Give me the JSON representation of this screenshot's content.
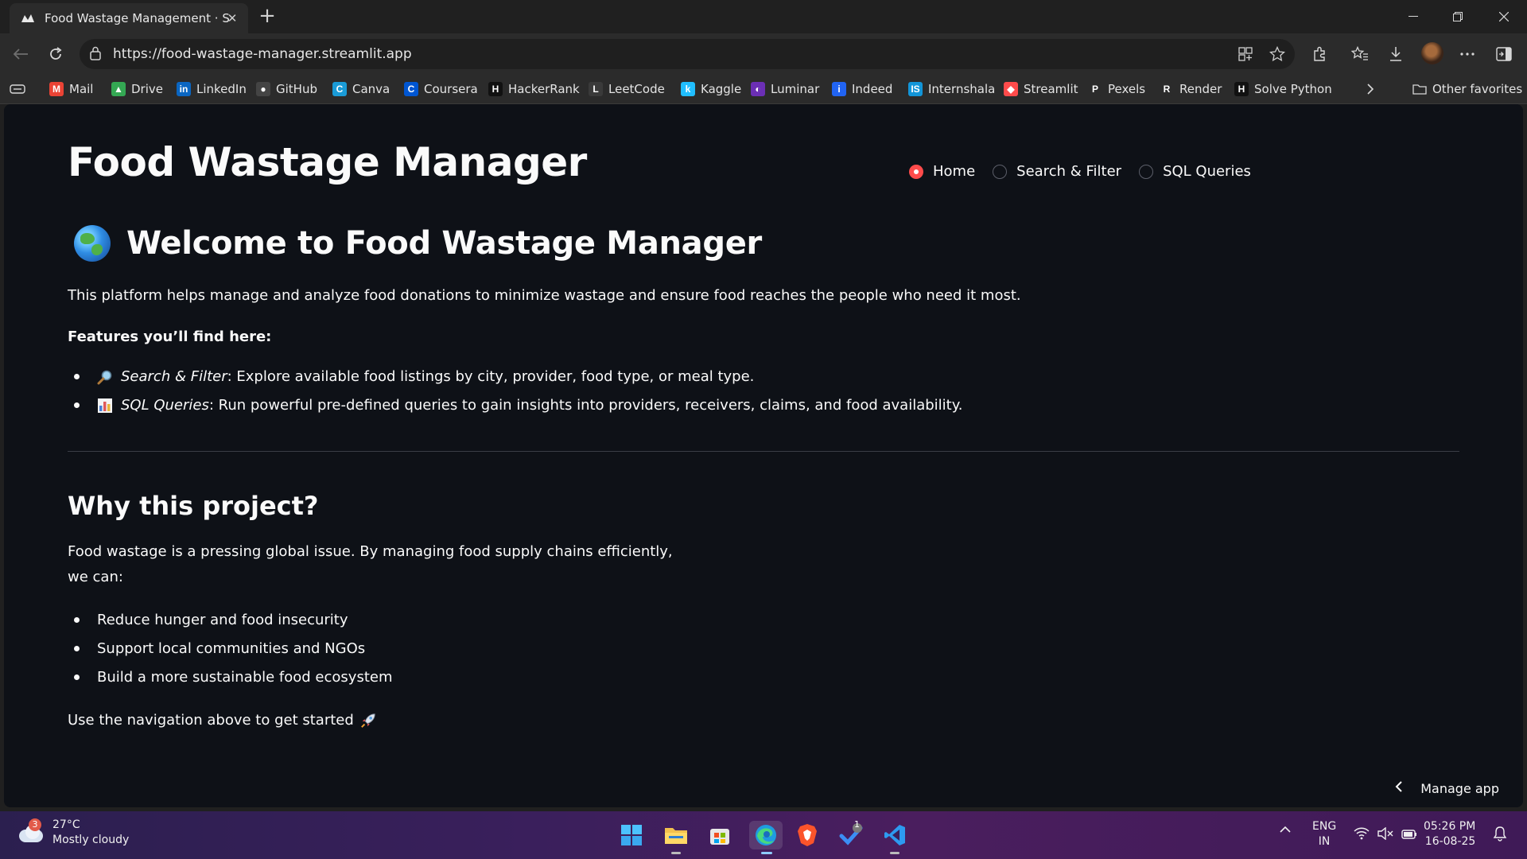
{
  "browser": {
    "tab_title": "Food Wastage Management · Streamlit",
    "url": "https://food-wastage-manager.streamlit.app",
    "bookmarks": [
      {
        "label": "Mail",
        "icon": "gmail-icon",
        "color": "#ea4335",
        "glyph": "M"
      },
      {
        "label": "Drive",
        "icon": "drive-icon",
        "color": "#34a853",
        "glyph": "▲"
      },
      {
        "label": "LinkedIn",
        "icon": "linkedin-icon",
        "color": "#0a66c2",
        "glyph": "in"
      },
      {
        "label": "GitHub",
        "icon": "github-icon",
        "color": "#444444",
        "glyph": "●"
      },
      {
        "label": "Canva",
        "icon": "canva-icon",
        "color": "#1a9bd7",
        "glyph": "C"
      },
      {
        "label": "Coursera",
        "icon": "coursera-icon",
        "color": "#0056d2",
        "glyph": "C"
      },
      {
        "label": "HackerRank",
        "icon": "hackerrank-icon",
        "color": "#111111",
        "glyph": "H"
      },
      {
        "label": "LeetCode",
        "icon": "leetcode-icon",
        "color": "#3a3a3a",
        "glyph": "L"
      },
      {
        "label": "Kaggle",
        "icon": "kaggle-icon",
        "color": "#20beff",
        "glyph": "k"
      },
      {
        "label": "Luminar",
        "icon": "luminar-icon",
        "color": "#6b2fb5",
        "glyph": "◐"
      },
      {
        "label": "Indeed",
        "icon": "indeed-icon",
        "color": "#2164f3",
        "glyph": "i"
      },
      {
        "label": "Internshala",
        "icon": "internshala-icon",
        "color": "#1295d8",
        "glyph": "IS"
      },
      {
        "label": "Streamlit",
        "icon": "streamlit-icon",
        "color": "#ff4b4b",
        "glyph": "◆"
      },
      {
        "label": "Pexels",
        "icon": "pexels-icon",
        "color": "#2b2b2b",
        "glyph": "P"
      },
      {
        "label": "Render",
        "icon": "render-icon",
        "color": "#2b2b2b",
        "glyph": "R"
      },
      {
        "label": "Solve Python",
        "icon": "solve-python-icon",
        "color": "#111111",
        "glyph": "H"
      }
    ],
    "other_favorites": "Other favorites"
  },
  "app": {
    "title": "Food Wastage Manager",
    "nav": [
      "Home",
      "Search & Filter",
      "SQL Queries"
    ],
    "nav_selected": "Home",
    "accent_color": "#ff4b4b",
    "welcome_heading": "Welcome to Food Wastage Manager",
    "intro": "This platform helps manage and analyze food donations to minimize wastage and ensure food reaches the people who need it most.",
    "features_heading": "Features you’ll find here:",
    "features": [
      {
        "name": "Search & Filter",
        "text": ": Explore available food listings by city, provider, food type, or meal type.",
        "icon": "magnifier-icon"
      },
      {
        "name": "SQL Queries",
        "text": ": Run powerful pre-defined queries to gain insights into providers, receivers, claims, and food availability.",
        "icon": "bar-chart-icon"
      }
    ],
    "why_heading": "Why this project?",
    "why_line1": "Food wastage is a pressing global issue. By managing food supply chains efficiently,",
    "why_line2": "we can:",
    "benefits": [
      "Reduce hunger and food insecurity",
      "Support local communities and NGOs",
      "Build a more sustainable food ecosystem"
    ],
    "cta": "Use the navigation above to get started",
    "manage_app": "Manage app"
  },
  "taskbar": {
    "weather_badge": "3",
    "temperature": "27°C",
    "condition": "Mostly cloudy",
    "store_badge": "1",
    "lang1": "ENG",
    "lang2": "IN",
    "time": "05:26 PM",
    "date": "16-08-25"
  }
}
